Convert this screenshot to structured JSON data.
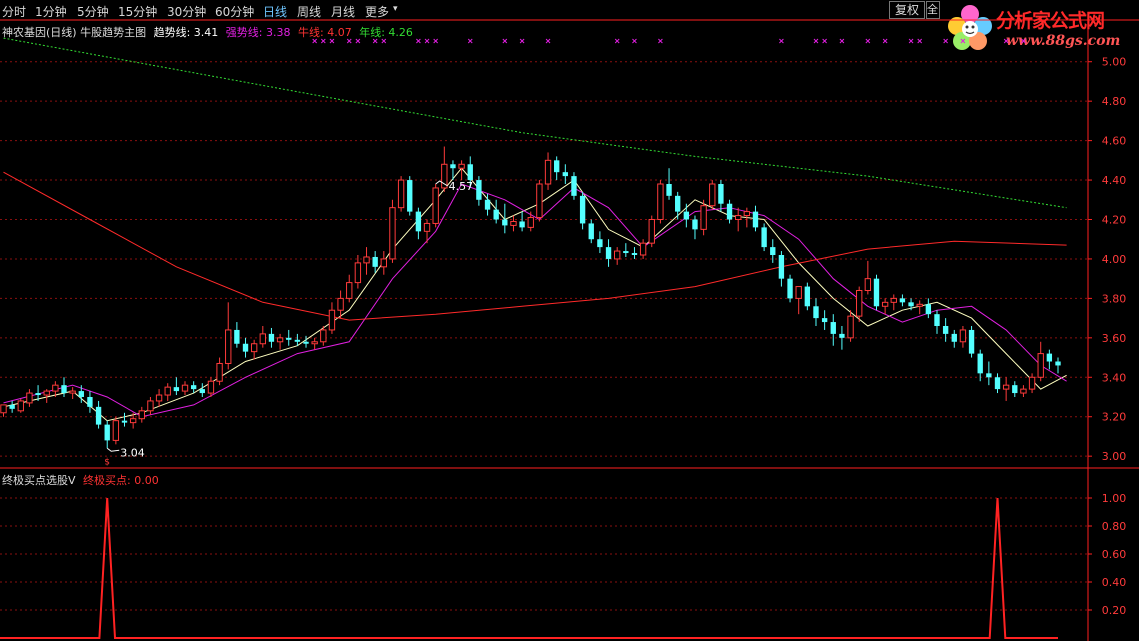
{
  "toolbar": {
    "tabs": [
      {
        "label": "分时",
        "active": false
      },
      {
        "label": "1分钟",
        "active": false
      },
      {
        "label": "5分钟",
        "active": false
      },
      {
        "label": "15分钟",
        "active": false
      },
      {
        "label": "30分钟",
        "active": false
      },
      {
        "label": "60分钟",
        "active": false
      },
      {
        "label": "日线",
        "active": true
      },
      {
        "label": "周线",
        "active": false
      },
      {
        "label": "月线",
        "active": false
      },
      {
        "label": "更多",
        "active": false
      }
    ],
    "more_arrow": "▾",
    "fuquan_label": "复权",
    "small_button_label": "全"
  },
  "logo": {
    "title": "分析家公式网",
    "url": "www.88gs.com"
  },
  "main_legend": {
    "title": "神农基因(日线) 牛股趋势主图",
    "items": [
      {
        "label": "趋势线: 3.41",
        "color": "#ffffff"
      },
      {
        "label": "强势线: 3.38",
        "color": "#e020e0"
      },
      {
        "label": "牛线: 4.07",
        "color": "#ff3333"
      },
      {
        "label": "年线: 4.26",
        "color": "#33dd33"
      }
    ]
  },
  "indicator_legend": {
    "title": "终极买点选股V",
    "items": [
      {
        "label": "终极买点: 0.00",
        "color": "#ff3333"
      }
    ]
  },
  "colors": {
    "up": "#ff3b3b",
    "down": "#54ffff",
    "axis": "#ff2020",
    "grid": "#8a1010",
    "trend": "#ffffc0",
    "strong": "#e020e0",
    "bull": "#ff2a2a",
    "year": "#33dd33",
    "marker": "#e020e0"
  },
  "chart_data": [
    {
      "type": "candlestick",
      "title": "神农基因(日线)",
      "ylim": [
        2.94,
        5.1
      ],
      "y_ticks": [
        "5.00",
        "4.80",
        "4.60",
        "4.40",
        "4.20",
        "4.00",
        "3.80",
        "3.60",
        "3.40",
        "3.20",
        "3.00"
      ],
      "annotations": [
        {
          "label": "4.57",
          "bar": 50
        },
        {
          "label": "3.04",
          "bar": 12
        }
      ],
      "candles": [
        [
          3.22,
          3.26,
          3.2,
          3.26
        ],
        [
          3.26,
          3.28,
          3.22,
          3.24
        ],
        [
          3.23,
          3.29,
          3.22,
          3.28
        ],
        [
          3.27,
          3.34,
          3.25,
          3.32
        ],
        [
          3.32,
          3.36,
          3.28,
          3.31
        ],
        [
          3.31,
          3.34,
          3.27,
          3.33
        ],
        [
          3.33,
          3.38,
          3.3,
          3.36
        ],
        [
          3.36,
          3.4,
          3.3,
          3.32
        ],
        [
          3.32,
          3.35,
          3.29,
          3.33
        ],
        [
          3.33,
          3.36,
          3.27,
          3.3
        ],
        [
          3.3,
          3.33,
          3.22,
          3.25
        ],
        [
          3.25,
          3.28,
          3.14,
          3.16
        ],
        [
          3.16,
          3.18,
          3.04,
          3.08
        ],
        [
          3.08,
          3.2,
          3.06,
          3.18
        ],
        [
          3.18,
          3.22,
          3.15,
          3.17
        ],
        [
          3.17,
          3.22,
          3.14,
          3.19
        ],
        [
          3.19,
          3.25,
          3.17,
          3.23
        ],
        [
          3.23,
          3.3,
          3.21,
          3.28
        ],
        [
          3.28,
          3.34,
          3.25,
          3.31
        ],
        [
          3.31,
          3.37,
          3.28,
          3.35
        ],
        [
          3.35,
          3.4,
          3.31,
          3.33
        ],
        [
          3.33,
          3.38,
          3.31,
          3.36
        ],
        [
          3.36,
          3.38,
          3.32,
          3.34
        ],
        [
          3.34,
          3.37,
          3.3,
          3.32
        ],
        [
          3.32,
          3.4,
          3.3,
          3.38
        ],
        [
          3.38,
          3.5,
          3.36,
          3.47
        ],
        [
          3.47,
          3.78,
          3.44,
          3.64
        ],
        [
          3.64,
          3.68,
          3.55,
          3.57
        ],
        [
          3.57,
          3.6,
          3.5,
          3.53
        ],
        [
          3.53,
          3.59,
          3.49,
          3.57
        ],
        [
          3.57,
          3.66,
          3.55,
          3.62
        ],
        [
          3.62,
          3.65,
          3.55,
          3.58
        ],
        [
          3.58,
          3.62,
          3.54,
          3.6
        ],
        [
          3.6,
          3.64,
          3.56,
          3.59
        ],
        [
          3.59,
          3.62,
          3.56,
          3.58
        ],
        [
          3.58,
          3.61,
          3.55,
          3.57
        ],
        [
          3.57,
          3.6,
          3.54,
          3.58
        ],
        [
          3.58,
          3.66,
          3.56,
          3.64
        ],
        [
          3.64,
          3.78,
          3.62,
          3.74
        ],
        [
          3.74,
          3.84,
          3.7,
          3.8
        ],
        [
          3.8,
          3.92,
          3.78,
          3.88
        ],
        [
          3.88,
          4.02,
          3.85,
          3.98
        ],
        [
          3.98,
          4.06,
          3.92,
          4.01
        ],
        [
          4.01,
          4.04,
          3.93,
          3.96
        ],
        [
          3.96,
          4.04,
          3.92,
          4.0
        ],
        [
          4.0,
          4.3,
          3.98,
          4.26
        ],
        [
          4.26,
          4.42,
          4.24,
          4.4
        ],
        [
          4.4,
          4.42,
          4.22,
          4.24
        ],
        [
          4.24,
          4.26,
          4.1,
          4.14
        ],
        [
          4.14,
          4.2,
          4.08,
          4.18
        ],
        [
          4.18,
          4.38,
          4.16,
          4.36
        ],
        [
          4.36,
          4.57,
          4.34,
          4.48
        ],
        [
          4.48,
          4.5,
          4.4,
          4.46
        ],
        [
          4.46,
          4.5,
          4.4,
          4.48
        ],
        [
          4.48,
          4.52,
          4.36,
          4.4
        ],
        [
          4.4,
          4.42,
          4.27,
          4.3
        ],
        [
          4.3,
          4.33,
          4.22,
          4.25
        ],
        [
          4.25,
          4.3,
          4.18,
          4.2
        ],
        [
          4.2,
          4.28,
          4.13,
          4.17
        ],
        [
          4.17,
          4.22,
          4.14,
          4.19
        ],
        [
          4.19,
          4.24,
          4.14,
          4.16
        ],
        [
          4.16,
          4.24,
          4.14,
          4.21
        ],
        [
          4.21,
          4.4,
          4.19,
          4.38
        ],
        [
          4.38,
          4.54,
          4.35,
          4.5
        ],
        [
          4.5,
          4.52,
          4.4,
          4.44
        ],
        [
          4.44,
          4.48,
          4.38,
          4.42
        ],
        [
          4.42,
          4.44,
          4.3,
          4.32
        ],
        [
          4.32,
          4.34,
          4.15,
          4.18
        ],
        [
          4.18,
          4.2,
          4.08,
          4.1
        ],
        [
          4.1,
          4.14,
          4.03,
          4.06
        ],
        [
          4.06,
          4.1,
          3.96,
          4.0
        ],
        [
          4.0,
          4.06,
          3.97,
          4.04
        ],
        [
          4.04,
          4.08,
          4.01,
          4.03
        ],
        [
          4.03,
          4.06,
          4.0,
          4.02
        ],
        [
          4.02,
          4.1,
          4.0,
          4.08
        ],
        [
          4.08,
          4.22,
          4.06,
          4.2
        ],
        [
          4.2,
          4.4,
          4.18,
          4.38
        ],
        [
          4.38,
          4.46,
          4.3,
          4.32
        ],
        [
          4.32,
          4.34,
          4.2,
          4.24
        ],
        [
          4.24,
          4.28,
          4.16,
          4.2
        ],
        [
          4.2,
          4.22,
          4.1,
          4.15
        ],
        [
          4.15,
          4.3,
          4.12,
          4.27
        ],
        [
          4.27,
          4.4,
          4.25,
          4.38
        ],
        [
          4.38,
          4.4,
          4.24,
          4.28
        ],
        [
          4.28,
          4.3,
          4.18,
          4.2
        ],
        [
          4.2,
          4.26,
          4.14,
          4.22
        ],
        [
          4.22,
          4.26,
          4.16,
          4.24
        ],
        [
          4.24,
          4.27,
          4.14,
          4.16
        ],
        [
          4.16,
          4.18,
          4.04,
          4.06
        ],
        [
          4.06,
          4.1,
          3.98,
          4.02
        ],
        [
          4.02,
          4.04,
          3.86,
          3.9
        ],
        [
          3.9,
          3.92,
          3.78,
          3.8
        ],
        [
          3.8,
          3.84,
          3.72,
          3.86
        ],
        [
          3.86,
          3.88,
          3.74,
          3.76
        ],
        [
          3.76,
          3.8,
          3.66,
          3.7
        ],
        [
          3.7,
          3.74,
          3.64,
          3.68
        ],
        [
          3.68,
          3.72,
          3.56,
          3.62
        ],
        [
          3.62,
          3.66,
          3.54,
          3.6
        ],
        [
          3.6,
          3.74,
          3.58,
          3.71
        ],
        [
          3.71,
          3.86,
          3.68,
          3.84
        ],
        [
          3.84,
          3.99,
          3.82,
          3.9
        ],
        [
          3.9,
          3.92,
          3.74,
          3.76
        ],
        [
          3.76,
          3.8,
          3.72,
          3.78
        ],
        [
          3.78,
          3.82,
          3.74,
          3.8
        ],
        [
          3.8,
          3.82,
          3.76,
          3.78
        ],
        [
          3.78,
          3.8,
          3.74,
          3.76
        ],
        [
          3.76,
          3.79,
          3.72,
          3.77
        ],
        [
          3.77,
          3.8,
          3.7,
          3.72
        ],
        [
          3.72,
          3.74,
          3.62,
          3.66
        ],
        [
          3.66,
          3.7,
          3.58,
          3.62
        ],
        [
          3.62,
          3.64,
          3.55,
          3.58
        ],
        [
          3.58,
          3.66,
          3.55,
          3.64
        ],
        [
          3.64,
          3.66,
          3.5,
          3.52
        ],
        [
          3.52,
          3.54,
          3.38,
          3.42
        ],
        [
          3.42,
          3.48,
          3.36,
          3.4
        ],
        [
          3.4,
          3.42,
          3.32,
          3.34
        ],
        [
          3.34,
          3.4,
          3.28,
          3.36
        ],
        [
          3.36,
          3.38,
          3.3,
          3.32
        ],
        [
          3.32,
          3.36,
          3.3,
          3.34
        ],
        [
          3.34,
          3.42,
          3.32,
          3.4
        ],
        [
          3.4,
          3.58,
          3.38,
          3.52
        ],
        [
          3.52,
          3.54,
          3.44,
          3.48
        ],
        [
          3.48,
          3.5,
          3.42,
          3.46
        ]
      ],
      "series": [
        {
          "name": "趋势线",
          "x": [
            0,
            8,
            12,
            16,
            22,
            28,
            34,
            40,
            45,
            50,
            53,
            58,
            62,
            66,
            70,
            74,
            80,
            84,
            88,
            92,
            96,
            100,
            104,
            108,
            112,
            116,
            120,
            123
          ],
          "values": [
            3.25,
            3.33,
            3.18,
            3.22,
            3.32,
            3.48,
            3.56,
            3.74,
            4.05,
            4.3,
            4.46,
            4.2,
            4.28,
            4.4,
            4.15,
            4.06,
            4.3,
            4.22,
            4.2,
            3.98,
            3.8,
            3.66,
            3.74,
            3.78,
            3.7,
            3.52,
            3.34,
            3.41
          ]
        },
        {
          "name": "强势线",
          "x": [
            0,
            8,
            12,
            16,
            22,
            28,
            34,
            40,
            45,
            50,
            53,
            58,
            62,
            66,
            70,
            74,
            80,
            84,
            88,
            92,
            96,
            100,
            104,
            108,
            112,
            116,
            120,
            123
          ],
          "values": [
            3.27,
            3.36,
            3.3,
            3.2,
            3.26,
            3.4,
            3.52,
            3.58,
            3.9,
            4.14,
            4.38,
            4.3,
            4.2,
            4.36,
            4.26,
            4.06,
            4.24,
            4.26,
            4.22,
            4.1,
            3.9,
            3.76,
            3.68,
            3.74,
            3.76,
            3.64,
            3.46,
            3.38
          ]
        },
        {
          "name": "牛线",
          "x": [
            0,
            10,
            20,
            30,
            40,
            50,
            60,
            70,
            80,
            90,
            100,
            110,
            123
          ],
          "values": [
            4.44,
            4.2,
            3.96,
            3.78,
            3.69,
            3.72,
            3.76,
            3.8,
            3.86,
            3.96,
            4.05,
            4.09,
            4.07
          ]
        },
        {
          "name": "年线",
          "x": [
            0,
            20,
            40,
            60,
            80,
            100,
            123
          ],
          "values": [
            5.12,
            4.96,
            4.8,
            4.64,
            4.52,
            4.42,
            4.26
          ]
        }
      ],
      "cross_markers_bars": [
        36,
        37,
        38,
        40,
        41,
        43,
        44,
        48,
        49,
        50,
        54,
        58,
        60,
        63,
        71,
        73,
        76,
        90,
        94,
        95,
        97,
        100,
        102,
        105,
        106,
        109,
        111,
        116,
        118
      ]
    },
    {
      "type": "line",
      "title": "终极买点选股V",
      "ylim": [
        0,
        1.1
      ],
      "y_ticks": [
        "1.00",
        "0.80",
        "0.60",
        "0.40",
        "0.20"
      ],
      "series": [
        {
          "name": "终极买点",
          "spikes_at_bars": [
            12,
            115
          ],
          "value": 1.0
        }
      ]
    }
  ]
}
